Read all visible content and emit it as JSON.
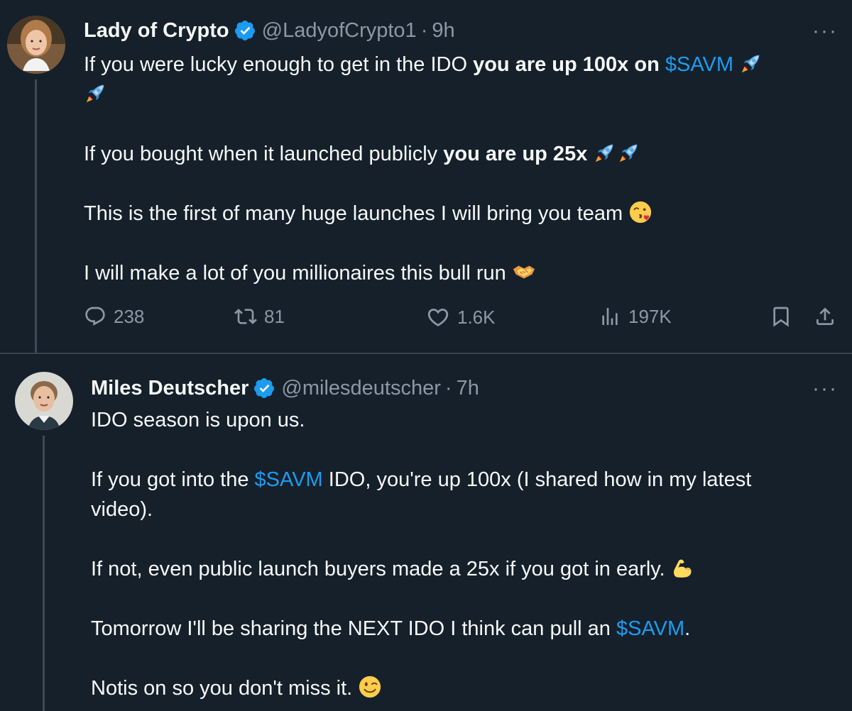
{
  "tweets": [
    {
      "name": "Lady of Crypto",
      "handle": "@LadyofCrypto1",
      "dot": "·",
      "time": "9h",
      "more": "···",
      "lines": {
        "l1a": "If you were lucky enough to get in the IDO ",
        "l1b": "you are up 100x on ",
        "l1c": "$SAVM",
        "l2a": "If you bought when it launched publicly ",
        "l2b": "you are up 25x",
        "l3": "This is the first of many huge launches I will bring you team",
        "l4": "I will make a lot of you millionaires this bull run"
      },
      "stats": {
        "replies": "238",
        "reposts": "81",
        "likes": "1.6K",
        "views": "197K"
      }
    },
    {
      "name": "Miles Deutscher",
      "handle": "@milesdeutscher",
      "dot": "·",
      "time": "7h",
      "more": "···",
      "lines": {
        "l1": "IDO season is upon us.",
        "l2a": "If you got into the ",
        "l2b": "$SAVM",
        "l2c": " IDO, you're up 100x (I shared how in my latest",
        "l2d": "video).",
        "l3": "If not, even public launch buyers made a 25x if you got in early.",
        "l4a": "Tomorrow I'll be sharing the NEXT IDO I think can pull an ",
        "l4b": "$SAVM",
        "l4c": ".",
        "l5": "Notis on so you don't miss it."
      }
    }
  ],
  "colors": {
    "background": "#15202b",
    "accent": "#1d9bf0",
    "muted": "#8b98a5",
    "text": "#f7f9f9"
  },
  "icons": [
    "verified-badge-icon",
    "rocket-emoji",
    "kissing-face-emoji",
    "handshake-emoji",
    "flexed-biceps-emoji",
    "winking-face-emoji",
    "reply-icon",
    "repost-icon",
    "like-icon",
    "views-icon",
    "bookmark-icon",
    "share-icon",
    "more-icon"
  ]
}
